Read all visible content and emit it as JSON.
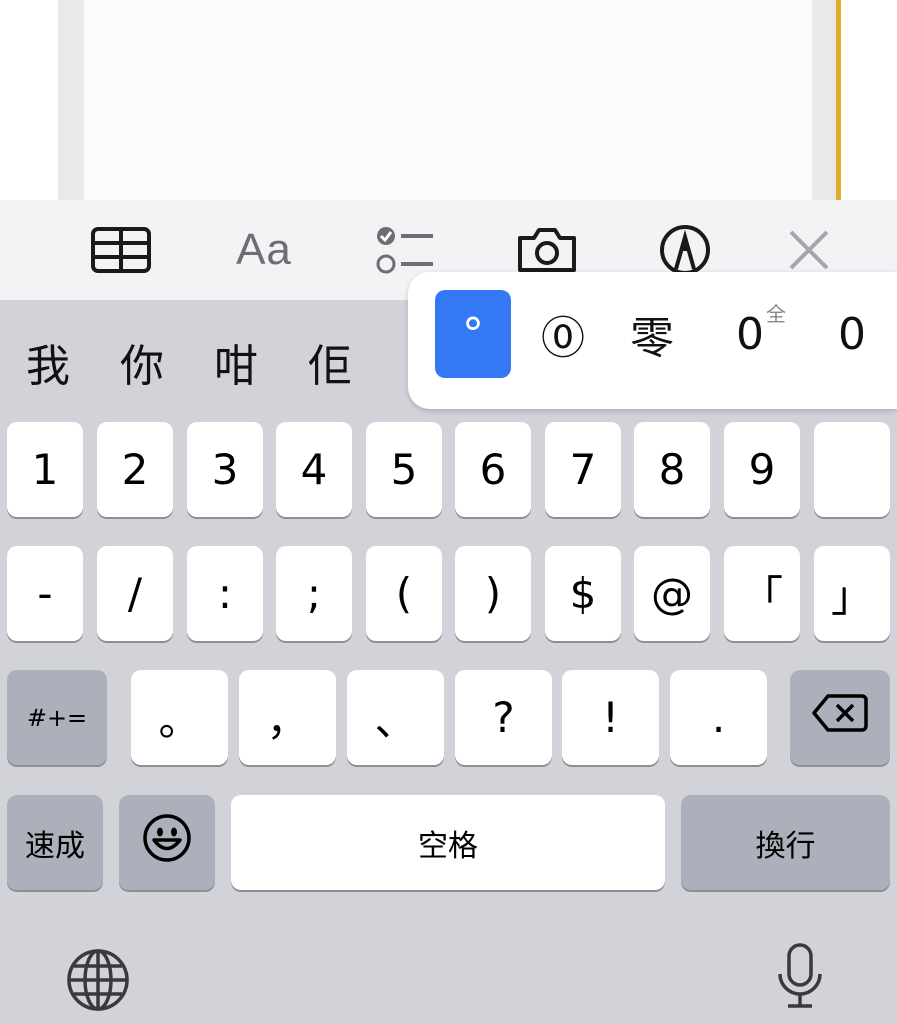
{
  "toolbar": {
    "table_icon": "table-icon",
    "format_label": "Aa",
    "checklist_icon": "checklist-icon",
    "camera_icon": "camera-icon",
    "markup_icon": "pen-markup-icon",
    "close_icon": "close-icon"
  },
  "candidates": [
    "我",
    "你",
    "咁",
    "佢"
  ],
  "popup": {
    "items": [
      "°",
      "⓪",
      "零",
      "0",
      "0"
    ],
    "selected_index": 0,
    "fullwidth_mark": "全"
  },
  "keyboard": {
    "row1": [
      "1",
      "2",
      "3",
      "4",
      "5",
      "6",
      "7",
      "8",
      "9"
    ],
    "row2": [
      "-",
      "/",
      ":",
      ";",
      "(",
      ")",
      "$",
      "@",
      "「",
      "」"
    ],
    "row3": [
      "。",
      "，",
      "、",
      "?",
      "!",
      "."
    ],
    "symbols_key": "#+=",
    "quick_key": "速成",
    "space_key": "空格",
    "return_key": "換行",
    "emoji_icon": "emoji-icon",
    "delete_icon": "backspace-icon",
    "globe_icon": "globe-icon",
    "mic_icon": "microphone-icon"
  },
  "colors": {
    "accent": "#3478f6",
    "key_bg": "#ffffff",
    "keyboard_bg": "#d1d3d9",
    "special_key_bg": "#abb0ba",
    "notes_yellow": "#e0ad2a"
  }
}
